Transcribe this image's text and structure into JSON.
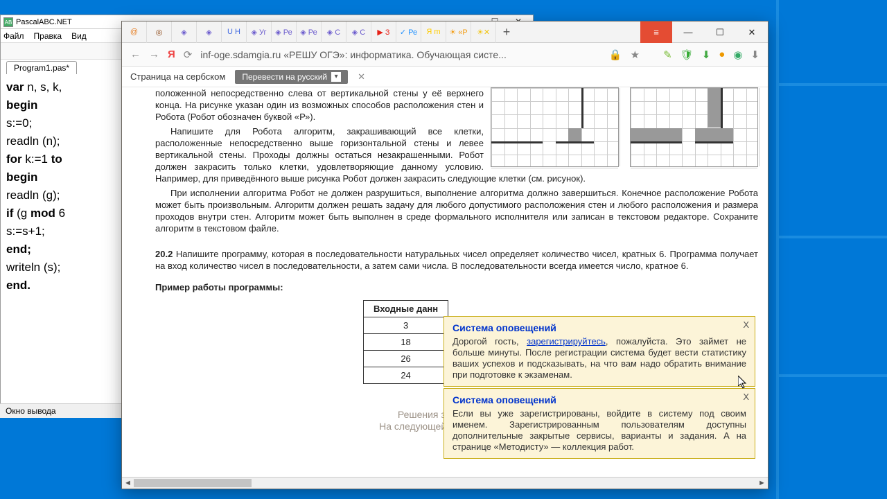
{
  "pascal": {
    "title": "PascalABC.NET",
    "menu": [
      "Файл",
      "Правка",
      "Вид"
    ],
    "tab": "Program1.pas*",
    "code_lines": [
      {
        "t": "var ",
        "kw": true
      },
      {
        "t": "n, s, k,\n"
      },
      {
        "t": "begin\n",
        "kw": true
      },
      {
        "t": "s:=0;\n"
      },
      {
        "t": "readln (n);\n"
      },
      {
        "t": "for ",
        "kw": true
      },
      {
        "t": "k:=1 "
      },
      {
        "t": "to\n",
        "kw": true
      },
      {
        "t": "begin\n",
        "kw": true
      },
      {
        "t": "readln (g);\n"
      },
      {
        "t": "if ",
        "kw": true
      },
      {
        "t": "(g "
      },
      {
        "t": "mod ",
        "kw": true
      },
      {
        "t": "6\n"
      },
      {
        "t": "s:=s+1;\n"
      },
      {
        "t": "end;\n",
        "kw": true
      },
      {
        "t": "writeln (s);\n"
      },
      {
        "t": "end.\n",
        "kw": true
      }
    ],
    "output_title": "Окно вывода"
  },
  "browser": {
    "tabs": [
      "@",
      "◎",
      "◈",
      "◈",
      "U Н",
      "◈ Уг",
      "◈ Ре",
      "◈ Ре",
      "◈ С",
      "◈ С",
      "▶ З",
      "✓ Ре",
      "Я m",
      "☀ «Р",
      "☀✕"
    ],
    "new_tab": "+",
    "menu_icon": "≡",
    "min_icon": "—",
    "max_icon": "☐",
    "close_icon": "✕",
    "nav_back": "←",
    "nav_fwd": "→",
    "nav_ya": "Я",
    "nav_reload": "⟳",
    "url_text": "inf-oge.sdamgia.ru   «РЕШУ ОГЭ»: информатика. Обучающая систе...",
    "addr_icons": [
      "🔒",
      "★"
    ],
    "ext_icons": [
      "✎",
      "🛡",
      "⬇",
      "●",
      "◉",
      "⬇"
    ],
    "translate_label": "Страница на сербском",
    "translate_btn": "Перевести на русский",
    "translate_close": "✕"
  },
  "content": {
    "p1": "положенной непосредственно слева от вертикальной стены у её верхнего конца. На рисунке указан один из возможных способов расположения стен и Робота (Робот обозначен буквой «Р»).",
    "p2": "Напишите для Робота алгоритм, закрашивающий все клетки, расположенные непосредственно выше горизонтальной стены и левее вертикальной стены. Проходы должны остаться незакрашенными. Робот должен закрасить только клетки, удовлетворяющие данному условию. Например, для приведённого выше рисунка Робот должен закрасить следующие клетки (см. рисунок).",
    "p3": "При исполнении алгоритма Робот не должен разрушиться, выполнение алгоритма должно завершиться. Конечное расположение Робота может быть произвольным. Алгоритм должен решать задачу для любого допустимого расположения стен и любого расположения и размера проходов внутри стен. Алгоритм может быть выполнен в среде формального исполнителя или записан в текстовом редакторе. Сохраните алгоритм в текстовом файле.",
    "t2_label": "20.2",
    "t2_text": " Напишите программу, которая в последовательности натуральных чисел определяет количество чисел, кратных 6. Программа получает на вход количество чисел в последовательности, а затем сами числа. В последовательности всегда имеется число, кратное 6.",
    "example_title": "Пример работы программы:",
    "table_header": "Входные данн",
    "table_vals": [
      "3",
      "18",
      "26",
      "24"
    ],
    "footer1": "Решения заданий части С",
    "footer2": "На следующей странице вам буде"
  },
  "notices": {
    "title": "Система оповещений",
    "close": "X",
    "n1a": "Дорогой гость, ",
    "n1link": "зарегистрируйтесь",
    "n1b": ", пожалуйста. Это займет не больше минуты. После регистрации система будет вести статистику ваших успехов и подсказывать, на что вам надо обратить внимание при подготовке к экзаменам.",
    "n2": "Если вы уже зарегистрированы, войдите в систему под своим именем. Зарегистрированным пользователям доступны дополнительные закрытые сервисы, варианты и задания. А на странице «Методисту» — коллекция работ."
  }
}
